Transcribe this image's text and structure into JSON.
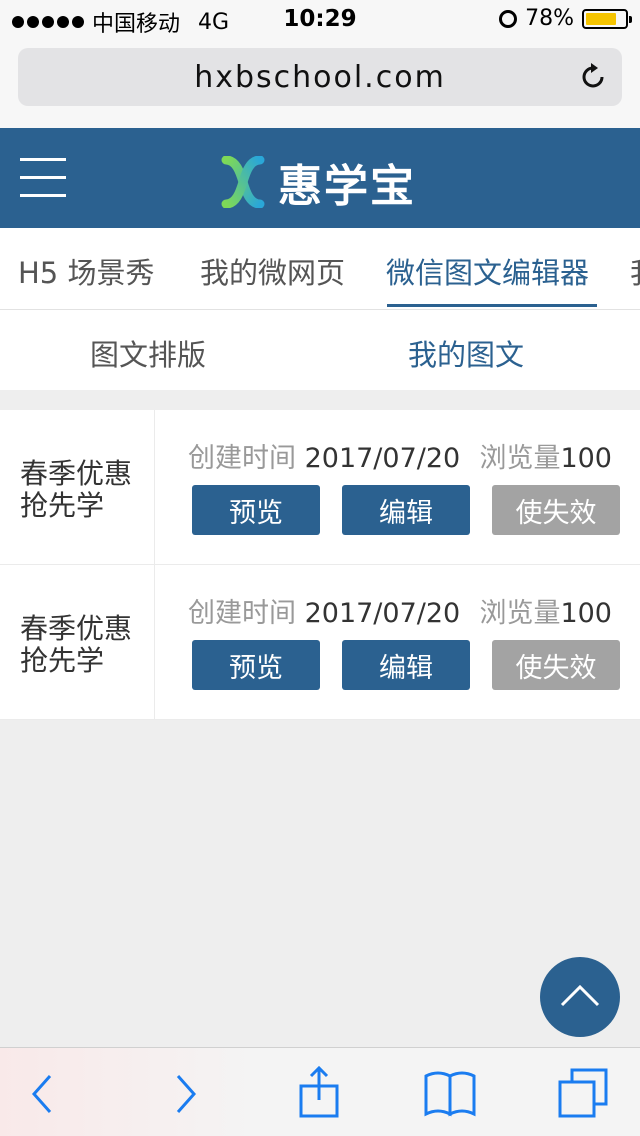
{
  "status": {
    "carrier": "中国移动",
    "network": "4G",
    "time": "10:29",
    "battery": "78%",
    "battery_level": 0.78
  },
  "browser": {
    "url": "hxbschool.com"
  },
  "header": {
    "logo_text": "惠学宝",
    "brand_color": "#2b6190"
  },
  "tabs": [
    {
      "label": "H5 场景秀"
    },
    {
      "label": "我的微网页"
    },
    {
      "label": "微信图文编辑器"
    },
    {
      "label": "我"
    }
  ],
  "subtabs": [
    {
      "label": "图文排版"
    },
    {
      "label": "我的图文"
    }
  ],
  "items": [
    {
      "title": "春季优惠抢先学",
      "created_label": "创建时间",
      "created_value": "2017/07/20",
      "views_label": "浏览量",
      "views_value": "100",
      "btn_preview": "预览",
      "btn_edit": "编辑",
      "btn_disable": "使失效"
    },
    {
      "title": "春季优惠抢先学",
      "created_label": "创建时间",
      "created_value": "2017/07/20",
      "views_label": "浏览量",
      "views_value": "100",
      "btn_preview": "预览",
      "btn_edit": "编辑",
      "btn_disable": "使失效"
    }
  ],
  "icons": {
    "menu": "hamburger-menu-icon",
    "reload": "reload-icon",
    "back_to_top": "chevron-up-icon",
    "toolbar": [
      "back-arrow-icon",
      "forward-arrow-icon",
      "share-icon",
      "bookmarks-icon",
      "tabs-icon"
    ]
  }
}
